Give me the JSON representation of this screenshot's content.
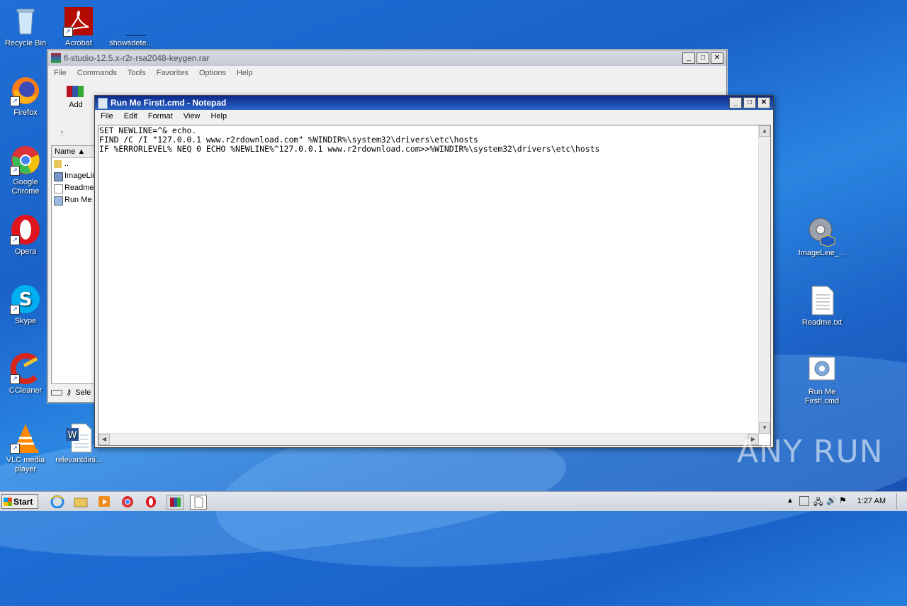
{
  "desktop": {
    "left_icons": [
      {
        "label": "Recycle Bin",
        "icon": "recycle-bin-icon"
      },
      {
        "label": "Firefox",
        "icon": "firefox-icon"
      },
      {
        "label": "Google Chrome",
        "icon": "chrome-icon"
      },
      {
        "label": "Opera",
        "icon": "opera-icon"
      },
      {
        "label": "Skype",
        "icon": "skype-icon"
      },
      {
        "label": "CCleaner",
        "icon": "ccleaner-icon"
      },
      {
        "label": "VLC media player",
        "icon": "vlc-icon"
      }
    ],
    "top_icons": [
      {
        "label": "Acrobat",
        "icon": "acrobat-icon"
      },
      {
        "label": "showsdete...",
        "icon": "blank-file-icon"
      }
    ],
    "bottom_icons": [
      {
        "label": "relevantdini...",
        "icon": "word-doc-icon"
      }
    ],
    "right_icons": [
      {
        "label": "ImageLine_...",
        "icon": "setup-icon"
      },
      {
        "label": "Readme.txt",
        "icon": "text-file-icon"
      },
      {
        "label": "Run Me First!.cmd",
        "icon": "cmd-file-icon"
      }
    ]
  },
  "winrar": {
    "title": "fl-studio-12.5.x-r2r-rsa2048-keygen.rar",
    "menu": [
      "File",
      "Commands",
      "Tools",
      "Favorites",
      "Options",
      "Help"
    ],
    "add_label": "Add",
    "list_header": "Name",
    "rows": [
      "..",
      "ImageLine",
      "Readme",
      "Run Me"
    ],
    "status": "Sele"
  },
  "notepad": {
    "title": "Run Me First!.cmd - Notepad",
    "menu": [
      "File",
      "Edit",
      "Format",
      "View",
      "Help"
    ],
    "content": "SET NEWLINE=^& echo.\nFIND /C /I \"127.0.0.1 www.r2rdownload.com\" %WINDIR%\\system32\\drivers\\etc\\hosts\nIF %ERRORLEVEL% NEQ 0 ECHO %NEWLINE%^127.0.0.1 www.r2rdownload.com>>%WINDIR%\\system32\\drivers\\etc\\hosts"
  },
  "taskbar": {
    "start_label": "Start",
    "clock": "1:27 AM"
  },
  "watermark": "ANY RUN"
}
